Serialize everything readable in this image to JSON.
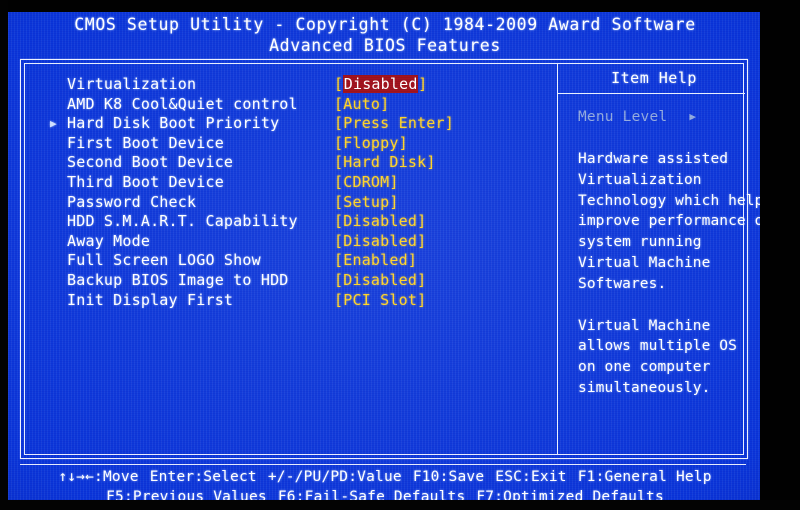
{
  "screen": {
    "background_color": "#0a34d8",
    "text_color": "#ffffff",
    "value_color": "#ffd21e",
    "highlight_background": "#9d0b16",
    "dim_text_color": "#8fa8dd"
  },
  "title": {
    "line1": "CMOS Setup Utility - Copyright (C) 1984-2009 Award Software",
    "line2": "Advanced BIOS Features"
  },
  "options": [
    {
      "marker": "",
      "label": "Virtualization",
      "value_open": "[",
      "value": "Disabled",
      "value_close": "]",
      "highlighted": true
    },
    {
      "marker": "",
      "label": "AMD K8 Cool&Quiet control",
      "value_open": "[",
      "value": "Auto",
      "value_close": "]",
      "highlighted": false
    },
    {
      "marker": "▶",
      "label": "Hard Disk Boot Priority",
      "value_open": "[",
      "value": "Press Enter",
      "value_close": "]",
      "highlighted": false
    },
    {
      "marker": "",
      "label": "First Boot Device",
      "value_open": "[",
      "value": "Floppy",
      "value_close": "]",
      "highlighted": false
    },
    {
      "marker": "",
      "label": "Second Boot Device",
      "value_open": "[",
      "value": "Hard Disk",
      "value_close": "]",
      "highlighted": false
    },
    {
      "marker": "",
      "label": "Third Boot Device",
      "value_open": "[",
      "value": "CDROM",
      "value_close": "]",
      "highlighted": false
    },
    {
      "marker": "",
      "label": "Password Check",
      "value_open": "[",
      "value": "Setup",
      "value_close": "]",
      "highlighted": false
    },
    {
      "marker": "",
      "label": "HDD S.M.A.R.T. Capability",
      "value_open": "[",
      "value": "Disabled",
      "value_close": "]",
      "highlighted": false
    },
    {
      "marker": "",
      "label": "Away Mode",
      "value_open": "[",
      "value": "Disabled",
      "value_close": "]",
      "highlighted": false
    },
    {
      "marker": "",
      "label": "Full Screen LOGO Show",
      "value_open": "[",
      "value": "Enabled",
      "value_close": "]",
      "highlighted": false
    },
    {
      "marker": "",
      "label": "Backup BIOS Image to HDD",
      "value_open": "[",
      "value": "Disabled",
      "value_close": "]",
      "highlighted": false
    },
    {
      "marker": "",
      "label": "Init Display First",
      "value_open": "[",
      "value": "PCI Slot",
      "value_close": "]",
      "highlighted": false
    }
  ],
  "help": {
    "title": "Item Help",
    "menu_level_label": "Menu Level",
    "menu_level_arrow": "▶",
    "paragraph1": [
      "Hardware assisted",
      "Virtualization",
      "Technology which help",
      "improve performance of",
      "system running",
      "Virtual Machine",
      "Softwares."
    ],
    "paragraph2": [
      "Virtual Machine",
      "allows multiple OS",
      "on one computer",
      "simultaneously."
    ]
  },
  "footer": {
    "row1": [
      "↑↓→←:Move",
      "Enter:Select",
      "+/-/PU/PD:Value",
      "F10:Save",
      "ESC:Exit",
      "F1:General Help"
    ],
    "row2": [
      "F5:Previous Values",
      "F6:Fail-Safe Defaults",
      "F7:Optimized Defaults"
    ]
  }
}
